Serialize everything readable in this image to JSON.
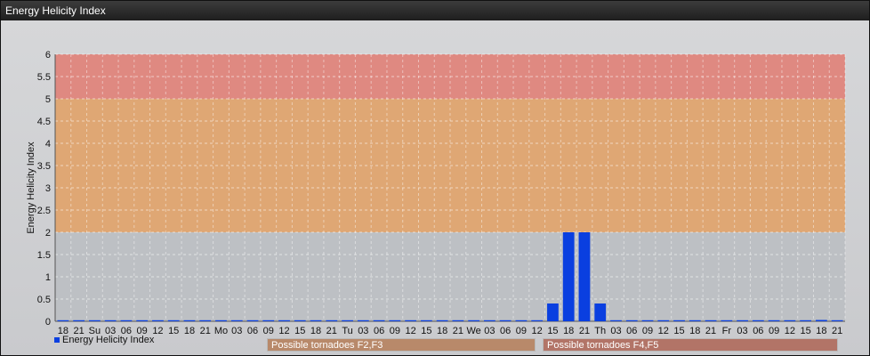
{
  "header": {
    "title": "Energy Helicity Index"
  },
  "legend": {
    "label": "Energy Helicity Index",
    "color": "#0a3fe0"
  },
  "bands": {
    "f23_label": "Possible tornadoes F2,F3",
    "f45_label": "Possible tornadoes F4,F5"
  },
  "chart_data": {
    "type": "bar",
    "title": "Energy Helicity Index",
    "ylabel": "Energy Helicity Index",
    "xlabel": "",
    "ylim": [
      0,
      6
    ],
    "yticks": [
      0,
      0.5,
      1,
      1.5,
      2,
      2.5,
      3,
      3.5,
      4,
      4.5,
      5,
      5.5,
      6
    ],
    "categories": [
      "18",
      "21",
      "Su",
      "03",
      "06",
      "09",
      "12",
      "15",
      "18",
      "21",
      "Mo",
      "03",
      "06",
      "09",
      "12",
      "15",
      "18",
      "21",
      "Tu",
      "03",
      "06",
      "09",
      "12",
      "15",
      "18",
      "21",
      "We",
      "03",
      "06",
      "09",
      "12",
      "15",
      "18",
      "21",
      "Th",
      "03",
      "06",
      "09",
      "12",
      "15",
      "18",
      "21",
      "Fr",
      "03",
      "06",
      "09",
      "12",
      "15",
      "18",
      "21"
    ],
    "series": [
      {
        "name": "Energy Helicity Index",
        "color": "#0a3fe0",
        "values": [
          0,
          0,
          0,
          0,
          0,
          0,
          0,
          0,
          0,
          0,
          0,
          0,
          0,
          0,
          0,
          0,
          0,
          0,
          0,
          0,
          0,
          0,
          0,
          0,
          0,
          0,
          0,
          0,
          0,
          0,
          0,
          0.4,
          2.0,
          2.0,
          0.4,
          0,
          0,
          0,
          0,
          0,
          0,
          0,
          0,
          0,
          0,
          0,
          0,
          0,
          0.03,
          0.02
        ]
      }
    ],
    "risk_bands": [
      {
        "from": 2,
        "to": 5,
        "color": "#e2a46c"
      },
      {
        "from": 5,
        "to": 6,
        "color": "#e2837a"
      }
    ],
    "grid": true
  }
}
